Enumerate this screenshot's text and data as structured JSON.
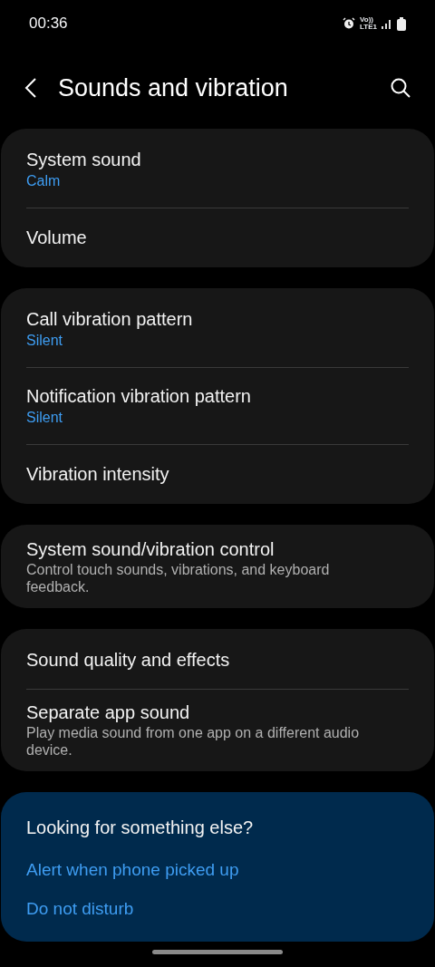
{
  "status_bar": {
    "time": "00:36",
    "network_label": [
      "Vo))",
      "LTE1"
    ]
  },
  "header": {
    "title": "Sounds and vibration"
  },
  "groups": [
    {
      "items": [
        {
          "kind": "value",
          "title": "System sound",
          "subtitle": "Calm"
        },
        {
          "kind": "plain",
          "title": "Volume"
        }
      ]
    },
    {
      "items": [
        {
          "kind": "value",
          "title": "Call vibration pattern",
          "subtitle": "Silent"
        },
        {
          "kind": "value",
          "title": "Notification vibration pattern",
          "subtitle": "Silent"
        },
        {
          "kind": "plain",
          "title": "Vibration intensity"
        }
      ]
    },
    {
      "items": [
        {
          "kind": "description",
          "title": "System sound/vibration control",
          "subtitle": "Control touch sounds, vibrations, and keyboard feedback."
        }
      ]
    },
    {
      "items": [
        {
          "kind": "plain",
          "title": "Sound quality and effects"
        },
        {
          "kind": "description",
          "title": "Separate app sound",
          "subtitle": "Play media sound from one app on a different audio device."
        }
      ]
    }
  ],
  "suggestions": {
    "title": "Looking for something else?",
    "links": [
      "Alert when phone picked up",
      "Do not disturb"
    ]
  }
}
